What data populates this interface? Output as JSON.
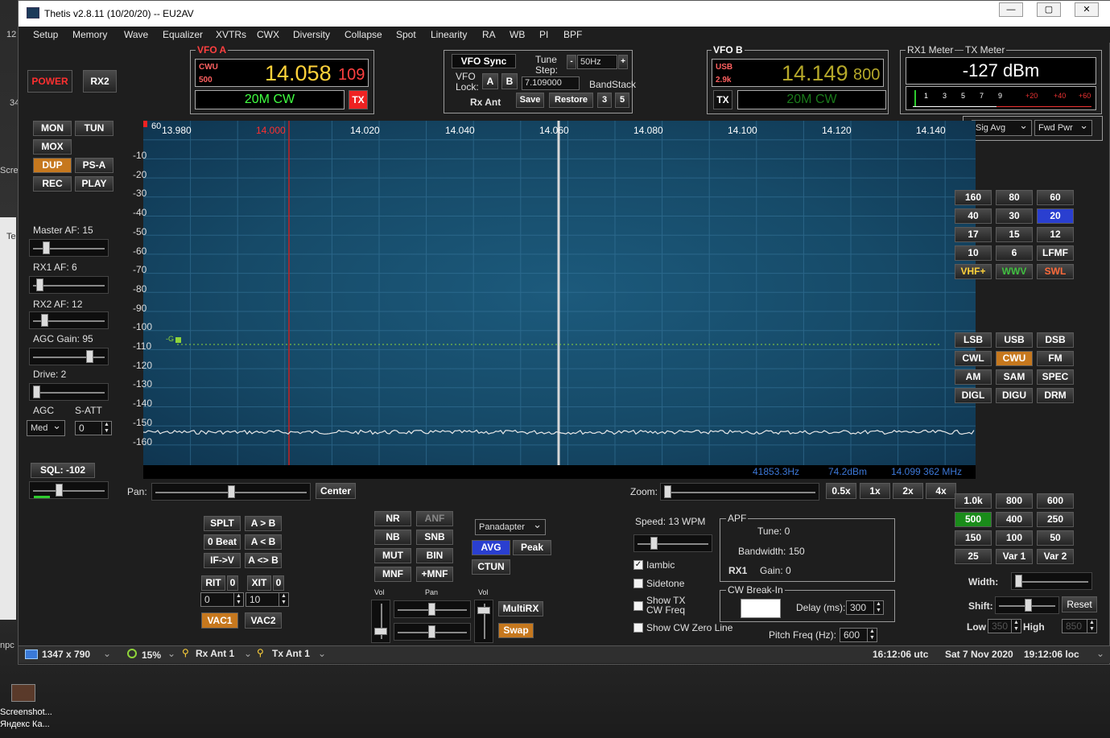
{
  "window": {
    "title": "Thetis v2.8.11 (10/20/20)   --  EU2AV",
    "min": "—",
    "max": "▢",
    "close": "✕"
  },
  "menu": [
    "Setup",
    "Memory",
    "Wave",
    "Equalizer",
    "XVTRs",
    "CWX",
    "Diversity",
    "Collapse",
    "Spot",
    "Linearity",
    "RA",
    "WB",
    "PI",
    "BPF"
  ],
  "desktop": {
    "left_frag1": "12",
    "left_frag2": "34",
    "left_frag3": "Scree",
    "left_frag4": "Te",
    "left_frag5": "npc",
    "icon_label": "Screenshot... Яндекс Ка..."
  },
  "left": {
    "power": "POWER",
    "rx2": "RX2",
    "mon": "MON",
    "tun": "TUN",
    "mox": "MOX",
    "dup": "DUP",
    "psa": "PS-A",
    "rec": "REC",
    "play": "PLAY",
    "master_af": "Master AF:  15",
    "rx1_af": "RX1 AF:  6",
    "rx2_af": "RX2 AF:  12",
    "agc_gain": "AGC Gain:  95",
    "drive": "Drive:  2",
    "agc": "AGC",
    "satt": "S-ATT",
    "agc_mode": "Med",
    "satt_val": "0",
    "sql": "SQL: -102"
  },
  "vfoa": {
    "label": "VFO A",
    "mode": "CWU",
    "filter": "500",
    "freq": "14.058",
    "sub": "109",
    "band": "20M CW",
    "tx": "TX"
  },
  "vfosync": {
    "sync": "VFO Sync",
    "tune": "Tune",
    "step": "Step:",
    "minus": "-",
    "step_val": "50Hz",
    "plus": "+",
    "vfo": "VFO",
    "lock": "Lock:",
    "a": "A",
    "b": "B",
    "lock_freq": "7.109000",
    "bandstack": "BandStack",
    "rxant": "Rx Ant",
    "save": "Save",
    "restore": "Restore",
    "n3": "3",
    "n5": "5"
  },
  "vfob": {
    "label": "VFO B",
    "mode": "USB",
    "filter": "2.9k",
    "freq": "14.149",
    "sub": "800",
    "band": "20M CW",
    "tx": "TX"
  },
  "meter": {
    "rx1": "RX1 Meter",
    "tx": "TX Meter",
    "value": "-127 dBm",
    "scale": [
      "1",
      "3",
      "5",
      "7",
      "9",
      "+20",
      "+40",
      "+60"
    ],
    "sig": "Sig Avg",
    "fwd": "Fwd Pwr"
  },
  "display": {
    "ref": "60",
    "freqs": [
      "13.980",
      "14.000",
      "14.020",
      "14.040",
      "14.060",
      "14.080",
      "14.100",
      "14.120",
      "14.140"
    ],
    "dbs": [
      "-10",
      "-20",
      "-30",
      "-40",
      "-50",
      "-60",
      "-70",
      "-80",
      "-90",
      "-100",
      "-110",
      "-120",
      "-130",
      "-140",
      "-150",
      "-160"
    ],
    "g": "-G",
    "status_hz": "41853.3Hz",
    "status_dbm": "74.2dBm",
    "status_mhz": "14.099 362 MHz"
  },
  "pan": {
    "pan": "Pan:",
    "center": "Center",
    "zoom": "Zoom:",
    "z05": "0.5x",
    "z1": "1x",
    "z2": "2x",
    "z4": "4x"
  },
  "bands": [
    "160",
    "80",
    "60",
    "40",
    "30",
    "20",
    "17",
    "15",
    "12",
    "10",
    "6",
    "LFMF",
    "VHF+",
    "WWV",
    "SWL"
  ],
  "modes": [
    "LSB",
    "USB",
    "DSB",
    "CWL",
    "CWU",
    "FM",
    "AM",
    "SAM",
    "SPEC",
    "DIGL",
    "DIGU",
    "DRM"
  ],
  "filters": [
    "1.0k",
    "800",
    "600",
    "500",
    "400",
    "250",
    "150",
    "100",
    "50",
    "25",
    "Var 1",
    "Var 2"
  ],
  "filterctl": {
    "width": "Width:",
    "shift": "Shift:",
    "reset": "Reset",
    "low": "Low",
    "low_val": "350",
    "high": "High",
    "high_val": "850"
  },
  "split": {
    "splt": "SPLT",
    "ab": "A > B",
    "zbeat": "0 Beat",
    "atb": "A < B",
    "ifv": "IF->V",
    "axb": "A <> B",
    "rit": "RIT",
    "rit_v": "0",
    "xit": "XIT",
    "xit_v": "0",
    "rit_spin": "0",
    "xit_spin": "10",
    "vac1": "VAC1",
    "vac2": "VAC2"
  },
  "dsp": {
    "nr": "NR",
    "anf": "ANF",
    "nb": "NB",
    "snb": "SNB",
    "mut": "MUT",
    "bin": "BIN",
    "mnf": "MNF",
    "pmnf": "+MNF",
    "panmode": "Panadapter",
    "avg": "AVG",
    "peak": "Peak",
    "ctun": "CTUN",
    "vol": "Vol",
    "pan": "Pan",
    "vol2": "Vol",
    "multirx": "MultiRX",
    "swap": "Swap"
  },
  "cw": {
    "speed": "Speed:  13 WPM",
    "iambic": "Iambic",
    "sidetone": "Sidetone",
    "showtx": "Show TX",
    "cwfreq": "CW Freq",
    "zero": "Show CW Zero Line",
    "apf": "APF",
    "tune": "Tune:  0",
    "bw": "Bandwidth:  150",
    "rx1": "RX1",
    "gain": "Gain:  0",
    "breakin": "CW Break-In",
    "delay": "Delay (ms):",
    "delay_v": "300",
    "pitch": "Pitch Freq (Hz):",
    "pitch_v": "600"
  },
  "status": {
    "res": "1347 x 790",
    "cpu": "15%",
    "rxant": "Rx Ant  1",
    "txant": "Tx Ant  1",
    "utc": "16:12:06 utc",
    "date": "Sat 7 Nov 2020",
    "loc": "19:12:06 loc"
  },
  "colors": {
    "vfo_a_freq": "#ffd23a",
    "vfo_b_freq": "#b5a82a",
    "band_green": "#40ff40",
    "selected_blue": "#2a3fd0",
    "dup_orange": "#c6781e",
    "filter_green": "#1a8c1a"
  }
}
